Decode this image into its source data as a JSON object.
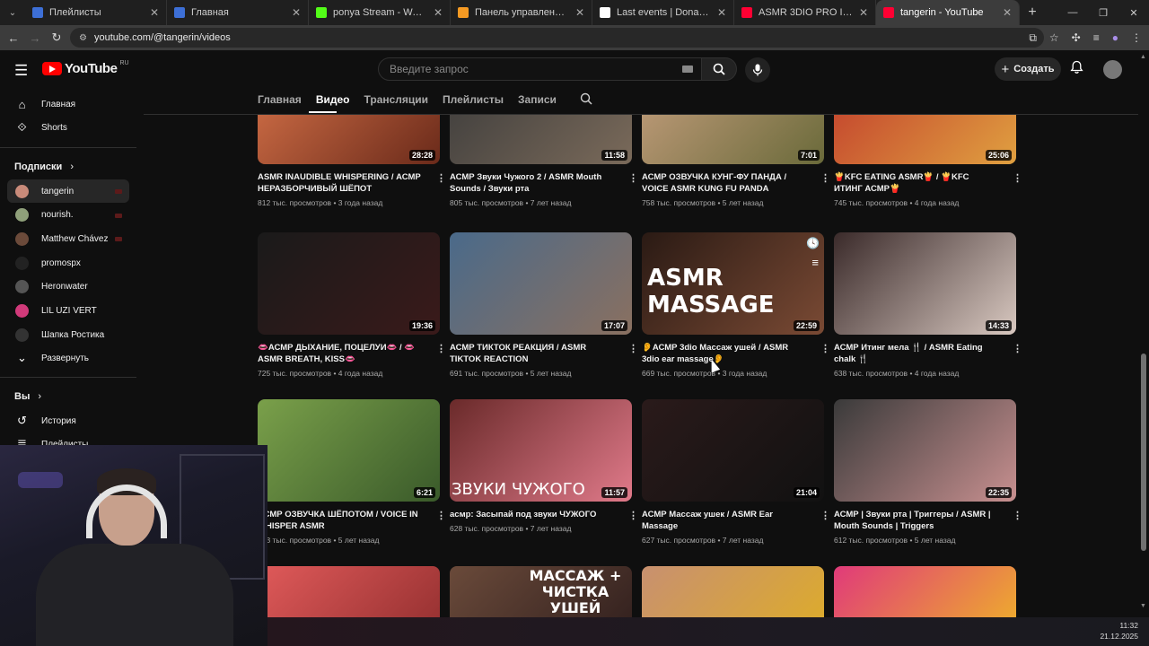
{
  "browser": {
    "tabs": [
      {
        "label": "Плейлисты",
        "fav_color": "#3d6fd6"
      },
      {
        "label": "Главная",
        "fav_color": "#3d6fd6"
      },
      {
        "label": "ponya Stream - Watch Live on",
        "fav_color": "#53fc18"
      },
      {
        "label": "Панель управления - Donatio",
        "fav_color": "#f59a23"
      },
      {
        "label": "Last events | DonatePay",
        "fav_color": "#ffffff"
      },
      {
        "label": "ASMR 3DIO PRO II / Рассыльк",
        "fav_color": "#ff0033"
      },
      {
        "label": "tangerin - YouTube",
        "fav_color": "#ff0033"
      }
    ],
    "url": "youtube.com/@tangerin/videos"
  },
  "header": {
    "logo_text": "YouTube",
    "logo_region": "RU",
    "search_placeholder": "Введите запрос",
    "create_label": "Создать"
  },
  "sidebar": {
    "main": [
      {
        "label": "Главная",
        "icon": "home-icon"
      },
      {
        "label": "Shorts",
        "icon": "shorts-icon"
      }
    ],
    "subs_heading": "Подписки",
    "subs": [
      {
        "label": "tangerin",
        "color": "#c98b7a",
        "live": true,
        "active": true
      },
      {
        "label": "nourish.",
        "color": "#8fa07a",
        "live": true
      },
      {
        "label": "Matthew Chávez",
        "color": "#6b4a3a",
        "live": true
      },
      {
        "label": "promospx",
        "color": "#222222",
        "live": false
      },
      {
        "label": "Heronwater",
        "color": "#555555",
        "live": false
      },
      {
        "label": "LIL UZI VERT",
        "color": "#d13a7a",
        "live": false
      },
      {
        "label": "Шапка Ростика",
        "color": "#333333",
        "live": false
      }
    ],
    "expand_label": "Развернуть",
    "you_heading": "Вы",
    "you_items": [
      {
        "label": "История",
        "icon": "history-icon"
      },
      {
        "label": "Плейлисты",
        "icon": "playlist-icon"
      }
    ]
  },
  "channel_tabs": [
    "Главная",
    "Видео",
    "Трансляции",
    "Плейлисты",
    "Записи"
  ],
  "active_tab": "Видео",
  "videos": [
    {
      "title": "ASMR INAUDIBLE WHISPERING / АСМР НЕРАЗБОРЧИВЫЙ ШЁПОТ",
      "views": "812 тыс. просмотров",
      "age": "3 года назад",
      "duration": "28:28",
      "bg": "linear-gradient(135deg,#d9744a,#6a2a1a)"
    },
    {
      "title": "АСМР Звуки Чужого 2 / ASMR Mouth Sounds / Звуки рта",
      "views": "805 тыс. просмотров",
      "age": "7 лет назад",
      "duration": "11:58",
      "bg": "linear-gradient(135deg,#3a3a3a,#7a6a5a)"
    },
    {
      "title": "АСМР ОЗВУЧКА КУНГ-ФУ ПАНДА / VOICE ASMR KUNG FU PANDA",
      "views": "758 тыс. просмотров",
      "age": "5 лет назад",
      "duration": "7:01",
      "bg": "linear-gradient(135deg,#c8a080,#6a6a3a)"
    },
    {
      "title": "🍟KFC EATING ASMR🍟 / 🍟KFC ИТИНГ АСМР🍟",
      "views": "745 тыс. просмотров",
      "age": "4 года назад",
      "duration": "25:06",
      "bg": "linear-gradient(135deg,#c0392b,#e0a040)"
    },
    {
      "title": "👄АСМР ДЫХАНИЕ, ПОЦЕЛУИ👄 / 👄 ASMR BREATH, KISS👄",
      "views": "725 тыс. просмотров",
      "age": "4 года назад",
      "duration": "19:36",
      "bg": "linear-gradient(135deg,#1a1a1a,#3a1a1a)"
    },
    {
      "title": "АСМР ТИКТОК РЕАКЦИЯ / ASMR TIKTOK REACTION",
      "views": "691 тыс. просмотров",
      "age": "5 лет назад",
      "duration": "17:07",
      "bg": "linear-gradient(135deg,#4a6a8a,#8a7060)"
    },
    {
      "title": "👂АСМР 3dio Массаж ушей / ASMR 3dio ear massage👂",
      "views": "669 тыс. просмотров",
      "age": "3 года назад",
      "duration": "22:59",
      "bg": "linear-gradient(135deg,#2a1a14,#7a4a34)",
      "overlay": "ASMR MASSAGE"
    },
    {
      "title": "АСМР Итинг мела 🍴 / ASMR Eating chalk 🍴",
      "views": "638 тыс. просмотров",
      "age": "4 года назад",
      "duration": "14:33",
      "bg": "linear-gradient(135deg,#3a2a2a,#d8c8c0)"
    },
    {
      "title": "АСМР ОЗВУЧКА ШЁПОТОМ / VOICE IN WHISPER ASMR",
      "views": "613 тыс. просмотров",
      "age": "5 лет назад",
      "duration": "6:21",
      "bg": "linear-gradient(135deg,#7aa04a,#3a5a2a)"
    },
    {
      "title": "асмр: Засыпай под звуки ЧУЖОГО",
      "views": "628 тыс. просмотров",
      "age": "7 лет назад",
      "duration": "11:57",
      "bg": "linear-gradient(135deg,#6a2a2a,#e07a8a)",
      "overlay": "ЗВУКИ ЧУЖОГО"
    },
    {
      "title": "АСМР Массаж ушек / ASMR Ear Massage",
      "views": "627 тыс. просмотров",
      "age": "7 лет назад",
      "duration": "21:04",
      "bg": "linear-gradient(135deg,#2a1a1a,#111111)"
    },
    {
      "title": "АСМР | Звуки рта | Триггеры / ASMR | Mouth Sounds | Triggers",
      "views": "612 тыс. просмотров",
      "age": "5 лет назад",
      "duration": "22:35",
      "bg": "linear-gradient(135deg,#3a3a3a,#c89090)"
    },
    {
      "title": "",
      "views": "",
      "age": "",
      "duration": "",
      "bg": "linear-gradient(135deg,#e05a5a,#8a2a2a)"
    },
    {
      "title": "",
      "views": "",
      "age": "",
      "duration": "",
      "bg": "linear-gradient(135deg,#6a4a3a,#2a1a1a)",
      "overlay": "МАССАЖ + ЧИСТКА УШЕЙ"
    },
    {
      "title": "",
      "views": "",
      "age": "",
      "duration": "",
      "bg": "linear-gradient(135deg,#c89070,#e0b020)"
    },
    {
      "title": "",
      "views": "",
      "age": "",
      "duration": "",
      "bg": "linear-gradient(135deg,#e03a7a,#f0c020)"
    }
  ],
  "clock": {
    "time": "11:32",
    "date": "21.12.2025"
  },
  "colors": {
    "accent": "#ff0000",
    "bg": "#0f0f0f"
  }
}
